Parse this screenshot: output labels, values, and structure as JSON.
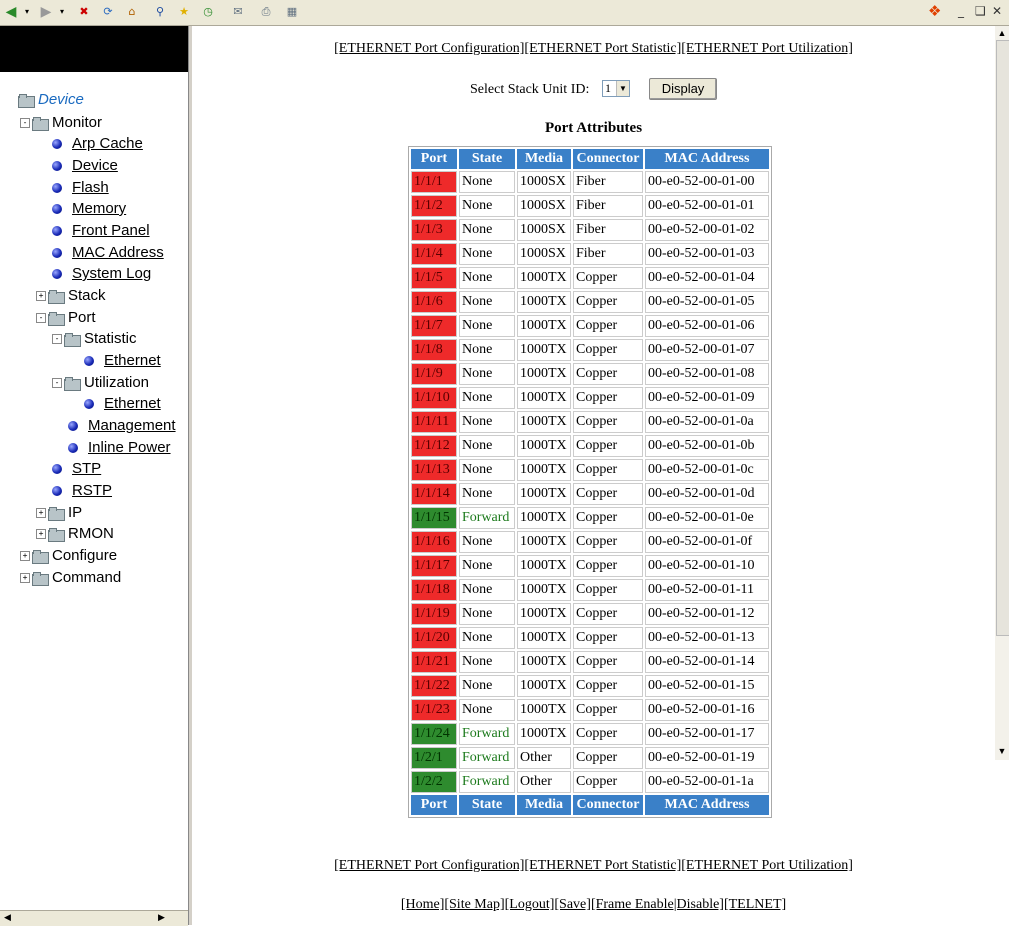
{
  "toolbar": {
    "buttons": [
      "back-icon",
      "forward-icon",
      "stop-icon",
      "refresh-icon",
      "home-icon",
      "search-icon",
      "favorites-icon",
      "history-icon",
      "mail-icon",
      "print-icon",
      "edit-icon"
    ],
    "window_controls": [
      "_",
      "❑",
      "✕"
    ]
  },
  "tree": {
    "root": "Device",
    "monitor": "Monitor",
    "arp_cache": "Arp Cache",
    "device": "Device",
    "flash": "Flash",
    "memory": "Memory",
    "front_panel": "Front Panel",
    "mac_address": "MAC Address",
    "system_log": "System Log",
    "stack": "Stack",
    "port": "Port",
    "statistic": "Statistic",
    "statistic_ethernet": "Ethernet",
    "utilization": "Utilization",
    "utilization_ethernet": "Ethernet",
    "management": "Management",
    "inline_power": "Inline Power",
    "stp": "STP",
    "rstp": "RSTP",
    "ip": "IP",
    "rmon": "RMON",
    "configure": "Configure",
    "command": "Command"
  },
  "top_links": {
    "config": "[ETHERNET Port Configuration]",
    "statistic": "[ETHERNET Port Statistic]",
    "utilization": "[ETHERNET Port Utilization]"
  },
  "stack_unit": {
    "label": "Select Stack Unit ID:",
    "value": "1",
    "button": "Display"
  },
  "table": {
    "title": "Port Attributes",
    "headers": [
      "Port",
      "State",
      "Media",
      "Connector",
      "MAC Address"
    ],
    "rows": [
      {
        "port": "1/1/1",
        "state": "None",
        "media": "1000SX",
        "connector": "Fiber",
        "mac": "00-e0-52-00-01-00",
        "status": "red"
      },
      {
        "port": "1/1/2",
        "state": "None",
        "media": "1000SX",
        "connector": "Fiber",
        "mac": "00-e0-52-00-01-01",
        "status": "red"
      },
      {
        "port": "1/1/3",
        "state": "None",
        "media": "1000SX",
        "connector": "Fiber",
        "mac": "00-e0-52-00-01-02",
        "status": "red"
      },
      {
        "port": "1/1/4",
        "state": "None",
        "media": "1000SX",
        "connector": "Fiber",
        "mac": "00-e0-52-00-01-03",
        "status": "red"
      },
      {
        "port": "1/1/5",
        "state": "None",
        "media": "1000TX",
        "connector": "Copper",
        "mac": "00-e0-52-00-01-04",
        "status": "red"
      },
      {
        "port": "1/1/6",
        "state": "None",
        "media": "1000TX",
        "connector": "Copper",
        "mac": "00-e0-52-00-01-05",
        "status": "red"
      },
      {
        "port": "1/1/7",
        "state": "None",
        "media": "1000TX",
        "connector": "Copper",
        "mac": "00-e0-52-00-01-06",
        "status": "red"
      },
      {
        "port": "1/1/8",
        "state": "None",
        "media": "1000TX",
        "connector": "Copper",
        "mac": "00-e0-52-00-01-07",
        "status": "red"
      },
      {
        "port": "1/1/9",
        "state": "None",
        "media": "1000TX",
        "connector": "Copper",
        "mac": "00-e0-52-00-01-08",
        "status": "red"
      },
      {
        "port": "1/1/10",
        "state": "None",
        "media": "1000TX",
        "connector": "Copper",
        "mac": "00-e0-52-00-01-09",
        "status": "red"
      },
      {
        "port": "1/1/11",
        "state": "None",
        "media": "1000TX",
        "connector": "Copper",
        "mac": "00-e0-52-00-01-0a",
        "status": "red"
      },
      {
        "port": "1/1/12",
        "state": "None",
        "media": "1000TX",
        "connector": "Copper",
        "mac": "00-e0-52-00-01-0b",
        "status": "red"
      },
      {
        "port": "1/1/13",
        "state": "None",
        "media": "1000TX",
        "connector": "Copper",
        "mac": "00-e0-52-00-01-0c",
        "status": "red"
      },
      {
        "port": "1/1/14",
        "state": "None",
        "media": "1000TX",
        "connector": "Copper",
        "mac": "00-e0-52-00-01-0d",
        "status": "red"
      },
      {
        "port": "1/1/15",
        "state": "Forward",
        "media": "1000TX",
        "connector": "Copper",
        "mac": "00-e0-52-00-01-0e",
        "status": "green"
      },
      {
        "port": "1/1/16",
        "state": "None",
        "media": "1000TX",
        "connector": "Copper",
        "mac": "00-e0-52-00-01-0f",
        "status": "red"
      },
      {
        "port": "1/1/17",
        "state": "None",
        "media": "1000TX",
        "connector": "Copper",
        "mac": "00-e0-52-00-01-10",
        "status": "red"
      },
      {
        "port": "1/1/18",
        "state": "None",
        "media": "1000TX",
        "connector": "Copper",
        "mac": "00-e0-52-00-01-11",
        "status": "red"
      },
      {
        "port": "1/1/19",
        "state": "None",
        "media": "1000TX",
        "connector": "Copper",
        "mac": "00-e0-52-00-01-12",
        "status": "red"
      },
      {
        "port": "1/1/20",
        "state": "None",
        "media": "1000TX",
        "connector": "Copper",
        "mac": "00-e0-52-00-01-13",
        "status": "red"
      },
      {
        "port": "1/1/21",
        "state": "None",
        "media": "1000TX",
        "connector": "Copper",
        "mac": "00-e0-52-00-01-14",
        "status": "red"
      },
      {
        "port": "1/1/22",
        "state": "None",
        "media": "1000TX",
        "connector": "Copper",
        "mac": "00-e0-52-00-01-15",
        "status": "red"
      },
      {
        "port": "1/1/23",
        "state": "None",
        "media": "1000TX",
        "connector": "Copper",
        "mac": "00-e0-52-00-01-16",
        "status": "red"
      },
      {
        "port": "1/1/24",
        "state": "Forward",
        "media": "1000TX",
        "connector": "Copper",
        "mac": "00-e0-52-00-01-17",
        "status": "green"
      },
      {
        "port": "1/2/1",
        "state": "Forward",
        "media": "Other",
        "connector": "Copper",
        "mac": "00-e0-52-00-01-19",
        "status": "green"
      },
      {
        "port": "1/2/2",
        "state": "Forward",
        "media": "Other",
        "connector": "Copper",
        "mac": "00-e0-52-00-01-1a",
        "status": "green"
      }
    ]
  },
  "bottom_links": {
    "config": "[ETHERNET Port Configuration]",
    "statistic": "[ETHERNET Port Statistic]",
    "utilization": "[ETHERNET Port Utilization]"
  },
  "footer_links": [
    "[Home]",
    "[Site Map]",
    "[Logout]",
    "[Save]",
    "[Frame Enable|Disable]",
    "[TELNET]"
  ],
  "colors": {
    "header_bg": "#3a80c8",
    "port_down": "#ee2a2a",
    "port_forward": "#2e8b2e"
  }
}
